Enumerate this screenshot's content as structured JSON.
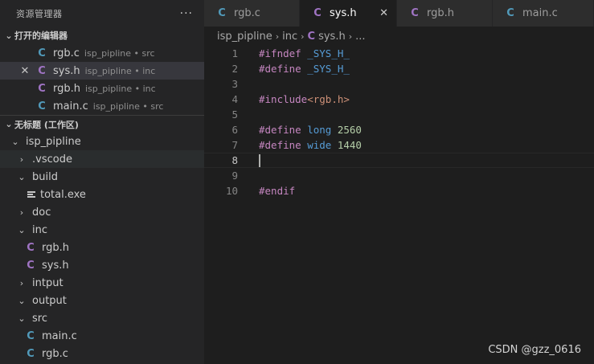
{
  "sidebar": {
    "title": "资源管理器",
    "more": "···",
    "open_editors": {
      "label": "打开的编辑器",
      "items": [
        {
          "icon": "C",
          "kind": "c",
          "name": "rgb.c",
          "desc": "isp_pipline • src"
        },
        {
          "icon": "C",
          "kind": "h",
          "name": "sys.h",
          "desc": "isp_pipline • inc",
          "close": "✕"
        },
        {
          "icon": "C",
          "kind": "h",
          "name": "rgb.h",
          "desc": "isp_pipline • inc"
        },
        {
          "icon": "C",
          "kind": "c",
          "name": "main.c",
          "desc": "isp_pipline • src"
        }
      ]
    },
    "workspace": {
      "label": "无标题 (工作区)",
      "root": "isp_pipline",
      "tree": [
        {
          "name": ".vscode",
          "type": "folder",
          "open": false
        },
        {
          "name": "build",
          "type": "folder",
          "open": true
        },
        {
          "name": "total.exe",
          "type": "file-exe"
        },
        {
          "name": "doc",
          "type": "folder",
          "open": false
        },
        {
          "name": "inc",
          "type": "folder",
          "open": true
        },
        {
          "name": "rgb.h",
          "type": "file-h",
          "icon": "C"
        },
        {
          "name": "sys.h",
          "type": "file-h",
          "icon": "C"
        },
        {
          "name": "intput",
          "type": "folder",
          "open": false
        },
        {
          "name": "output",
          "type": "folder",
          "open": true
        },
        {
          "name": "src",
          "type": "folder",
          "open": true
        },
        {
          "name": "main.c",
          "type": "file-c",
          "icon": "C"
        },
        {
          "name": "rgb.c",
          "type": "file-c",
          "icon": "C"
        }
      ]
    }
  },
  "tabs": [
    {
      "icon": "C",
      "kind": "c",
      "label": "rgb.c"
    },
    {
      "icon": "C",
      "kind": "h",
      "label": "sys.h",
      "active": true,
      "close": "✕"
    },
    {
      "icon": "C",
      "kind": "h",
      "label": "rgb.h"
    },
    {
      "icon": "C",
      "kind": "c",
      "label": "main.c"
    }
  ],
  "breadcrumb": {
    "folder": "isp_pipline",
    "sub": "inc",
    "file_icon": "C",
    "file": "sys.h",
    "sep": "›",
    "more": "..."
  },
  "code": [
    {
      "n": "1",
      "tokens": [
        [
          "kw",
          "#ifndef"
        ],
        [
          "",
          " "
        ],
        [
          "id",
          "_SYS_H_"
        ]
      ]
    },
    {
      "n": "2",
      "tokens": [
        [
          "kw",
          "#define"
        ],
        [
          "",
          " "
        ],
        [
          "id",
          "_SYS_H_"
        ]
      ]
    },
    {
      "n": "3",
      "tokens": []
    },
    {
      "n": "4",
      "tokens": [
        [
          "kw",
          "#include"
        ],
        [
          "str",
          "<rgb.h>"
        ]
      ]
    },
    {
      "n": "5",
      "tokens": []
    },
    {
      "n": "6",
      "tokens": [
        [
          "kw",
          "#define"
        ],
        [
          "",
          " "
        ],
        [
          "id",
          "long"
        ],
        [
          "",
          " "
        ],
        [
          "num",
          "2560"
        ]
      ]
    },
    {
      "n": "7",
      "tokens": [
        [
          "kw",
          "#define"
        ],
        [
          "",
          " "
        ],
        [
          "id",
          "wide"
        ],
        [
          "",
          " "
        ],
        [
          "num",
          "1440"
        ]
      ]
    },
    {
      "n": "8",
      "tokens": [],
      "current": true
    },
    {
      "n": "9",
      "tokens": []
    },
    {
      "n": "10",
      "tokens": [
        [
          "kw",
          "#endif"
        ]
      ]
    }
  ],
  "watermark": "CSDN @gzz_0616",
  "colors": {
    "c_icon": "#519aba",
    "h_icon": "#a074c4",
    "keyword": "#c586c0",
    "identifier": "#569cd6",
    "number": "#b5cea8",
    "string": "#ce9178"
  }
}
